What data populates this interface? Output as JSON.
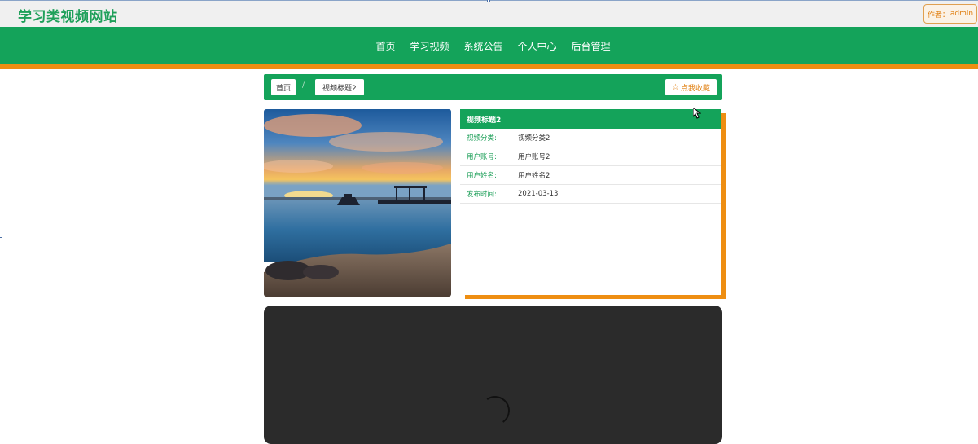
{
  "header": {
    "site_title": "学习类视频网站",
    "author_label": "作者：",
    "author_name": "admin"
  },
  "nav": {
    "items": [
      {
        "label": "首页"
      },
      {
        "label": "学习视频"
      },
      {
        "label": "系统公告"
      },
      {
        "label": "个人中心"
      },
      {
        "label": "后台管理"
      }
    ]
  },
  "breadcrumb": {
    "home": "首页",
    "separator": "/",
    "current": "视频标题2"
  },
  "favorite_button": {
    "icon": "star-outline-icon",
    "label": "点我收藏"
  },
  "cover": {
    "icon": "sunset-pier-photo"
  },
  "details": {
    "title": "视频标题2",
    "rows": [
      {
        "key": "视频分类:",
        "value": "视频分类2"
      },
      {
        "key": "用户账号:",
        "value": "用户账号2"
      },
      {
        "key": "用户姓名:",
        "value": "用户姓名2"
      },
      {
        "key": "发布时间:",
        "value": "2021-03-13"
      }
    ]
  },
  "player": {
    "state": "loading"
  },
  "colors": {
    "brand_green": "#14a35a",
    "accent_orange": "#ee8e12",
    "title_green": "#1fa05a"
  }
}
